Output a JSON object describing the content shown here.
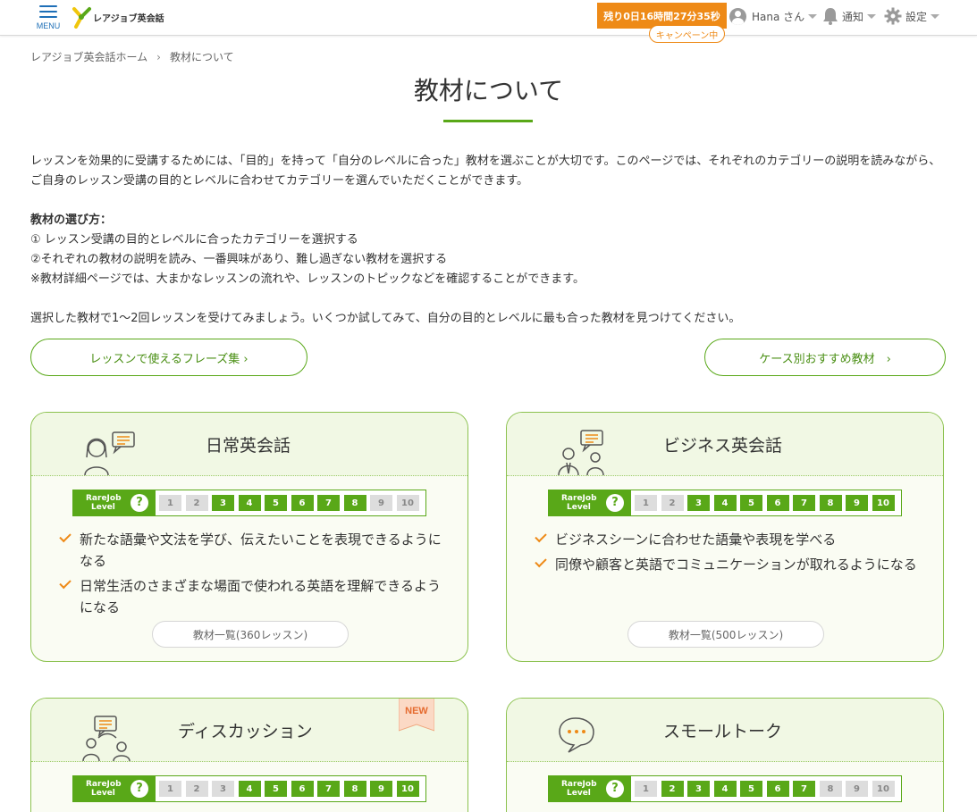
{
  "header": {
    "menu_label": "MENU",
    "logo_text": "レアジョブ英会話",
    "timer": "残り0日16時間27分35秒",
    "campaign": "キャンペーン中",
    "user_name": "Hana さん",
    "notifications_label": "通知",
    "settings_label": "設定"
  },
  "breadcrumb": {
    "home": "レアジョブ英会話ホーム",
    "current": "教材について"
  },
  "page_title": "教材について",
  "intro": {
    "paragraph1": "レッスンを効果的に受講するためには、「目的」を持って「自分のレベルに合った」教材を選ぶことが大切です。このページでは、それぞれのカテゴリーの説明を読みながら、ご自身のレッスン受講の目的とレベルに合わせてカテゴリーを選んでいただくことができます。",
    "howto_heading": "教材の選び方：",
    "step1": "① レッスン受講の目的とレベルに合ったカテゴリーを選択する",
    "step2": "②それぞれの教材の説明を読み、一番興味があり、難し過ぎない教材を選択する",
    "note": "※教材詳細ページでは、大まかなレッスンの流れや、レッスンのトピックなどを確認することができます。",
    "paragraph2": "選択した教材で1〜2回レッスンを受けてみましょう。いくつか試してみて、自分の目的とレベルに最も合った教材を見つけてください。"
  },
  "buttons": {
    "phrases": "レッスンで使えるフレーズ集 ›",
    "case": "ケース別おすすめ教材　›"
  },
  "level_label_line1": "RareJob",
  "level_label_line2": "Level",
  "level_help": "?",
  "levels": [
    "1",
    "2",
    "3",
    "4",
    "5",
    "6",
    "7",
    "8",
    "9",
    "10"
  ],
  "new_badge": "NEW",
  "cards": [
    {
      "title": "日常英会話",
      "active_levels": [
        3,
        4,
        5,
        6,
        7,
        8
      ],
      "features": [
        "新たな語彙や文法を学び、伝えたいことを表現できるようになる",
        "日常生活のさまざまな場面で使われる英語を理解できるようになる"
      ],
      "list_button": "教材一覧(360レッスン)",
      "icon": "person-speech-icon"
    },
    {
      "title": "ビジネス英会話",
      "active_levels": [
        3,
        4,
        5,
        6,
        7,
        8,
        9,
        10
      ],
      "features": [
        "ビジネスシーンに合わせた語彙や表現を学べる",
        "同僚や顧客と英語でコミュニケーションが取れるようになる"
      ],
      "list_button": "教材一覧(500レッスン)",
      "icon": "business-people-icon"
    },
    {
      "title": "ディスカッション",
      "active_levels": [
        4,
        5,
        6,
        7,
        8,
        9,
        10
      ],
      "icon": "discussion-icon"
    },
    {
      "title": "スモールトーク",
      "active_levels": [
        2,
        3,
        4,
        5,
        6,
        7
      ],
      "icon": "chat-bubble-icon"
    }
  ],
  "colors": {
    "accent_green": "#59a818",
    "orange": "#ee8a17",
    "menu_blue": "#1e6fb7"
  }
}
